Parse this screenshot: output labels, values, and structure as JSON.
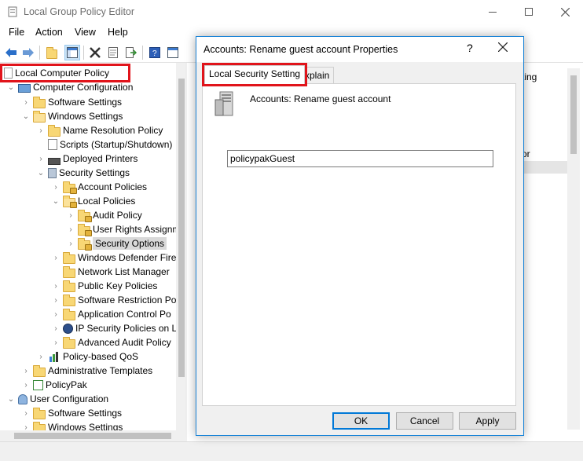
{
  "app": {
    "title": "Local Group Policy Editor",
    "menu": [
      "File",
      "Action",
      "View",
      "Help"
    ]
  },
  "tree": {
    "items": [
      {
        "label": "Local Computer Policy"
      },
      {
        "label": "Computer Configuration"
      },
      {
        "label": "Software Settings"
      },
      {
        "label": "Windows Settings"
      },
      {
        "label": "Name Resolution Policy"
      },
      {
        "label": "Scripts (Startup/Shutdown)"
      },
      {
        "label": "Deployed Printers"
      },
      {
        "label": "Security Settings"
      },
      {
        "label": "Account Policies"
      },
      {
        "label": "Local Policies"
      },
      {
        "label": "Audit Policy"
      },
      {
        "label": "User Rights Assignment"
      },
      {
        "label": "Security Options"
      },
      {
        "label": "Windows Defender Firewall"
      },
      {
        "label": "Network List Manager"
      },
      {
        "label": "Public Key Policies"
      },
      {
        "label": "Software Restriction Po"
      },
      {
        "label": "Application Control Po"
      },
      {
        "label": "IP Security Policies on L"
      },
      {
        "label": "Advanced Audit Policy"
      },
      {
        "label": "Policy-based QoS"
      },
      {
        "label": "Administrative Templates"
      },
      {
        "label": "PolicyPak"
      },
      {
        "label": "User Configuration"
      },
      {
        "label": "Software Settings"
      },
      {
        "label": "Windows Settings"
      }
    ]
  },
  "right_pane": {
    "col_header_fragment": "ting",
    "text_fragment": "or"
  },
  "dialog": {
    "title": "Accounts: Rename guest account Properties",
    "help_glyph": "?",
    "tabs": [
      "Local Security Setting",
      "Explain"
    ],
    "policy_name": "Accounts: Rename guest account",
    "value": "policypakGuest",
    "buttons": {
      "ok": "OK",
      "cancel": "Cancel",
      "apply": "Apply"
    }
  },
  "colors": {
    "highlight_box": "#e1141b",
    "accent": "#0078d7"
  }
}
